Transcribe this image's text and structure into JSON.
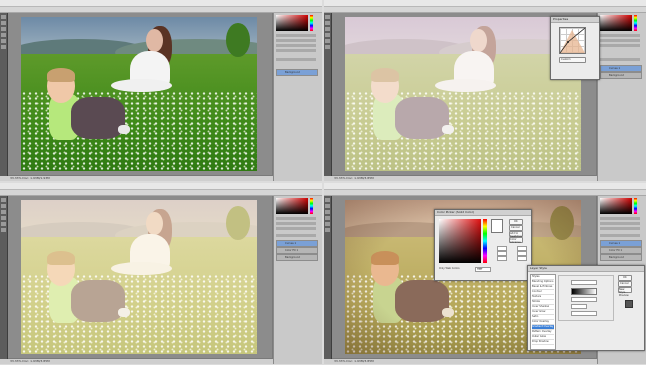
{
  "windows": [
    {
      "id": "tl",
      "status": "33.33% Doc: 1.93M/1.93M",
      "layers": [
        "Background"
      ],
      "tone": "original"
    },
    {
      "id": "tr",
      "status": "33.33% Doc: 1.93M/3.85M",
      "layers": [
        "Curves 1",
        "Background"
      ],
      "tone": "faded"
    },
    {
      "id": "bl",
      "status": "33.33% Doc: 1.93M/3.85M",
      "layers": [
        "Curves 1",
        "Color Fill 1",
        "Background"
      ],
      "tone": "warm"
    },
    {
      "id": "br",
      "status": "33.33% Doc: 1.93M/3.85M",
      "layers": [
        "Curves 1",
        "Color Fill 1",
        "Background"
      ],
      "tone": "vintage"
    }
  ],
  "dialogs": {
    "curves": {
      "title": "Properties",
      "preset": "Custom"
    },
    "color_picker": {
      "title": "Color Picker (Solid Color)",
      "ok_label": "OK",
      "cancel_label": "Cancel",
      "add_label": "Add to Swatches",
      "libs_label": "Color Libraries",
      "only_web": "Only Web Colors",
      "hex_value": "ffffff"
    },
    "layer_style": {
      "title": "Layer Style",
      "items": [
        "Styles",
        "Blending Options",
        "Bevel & Emboss",
        "Contour",
        "Texture",
        "Stroke",
        "Inner Shadow",
        "Inner Glow",
        "Satin",
        "Color Overlay",
        "Gradient Overlay",
        "Pattern Overlay",
        "Outer Glow",
        "Drop Shadow"
      ],
      "selected": "Gradient Overlay",
      "ok_label": "OK",
      "cancel_label": "Cancel",
      "new_label": "New Style...",
      "preview_label": "Preview"
    }
  },
  "colors": {
    "ui_bg": "#dcdcdc",
    "panel": "#c9c9c9",
    "canvas": "#8c8c8c",
    "selection": "#3b7fd6"
  },
  "icons": [
    "brush-icon",
    "move-icon",
    "lasso-icon",
    "crop-icon",
    "eyedropper-icon",
    "zoom-icon"
  ]
}
